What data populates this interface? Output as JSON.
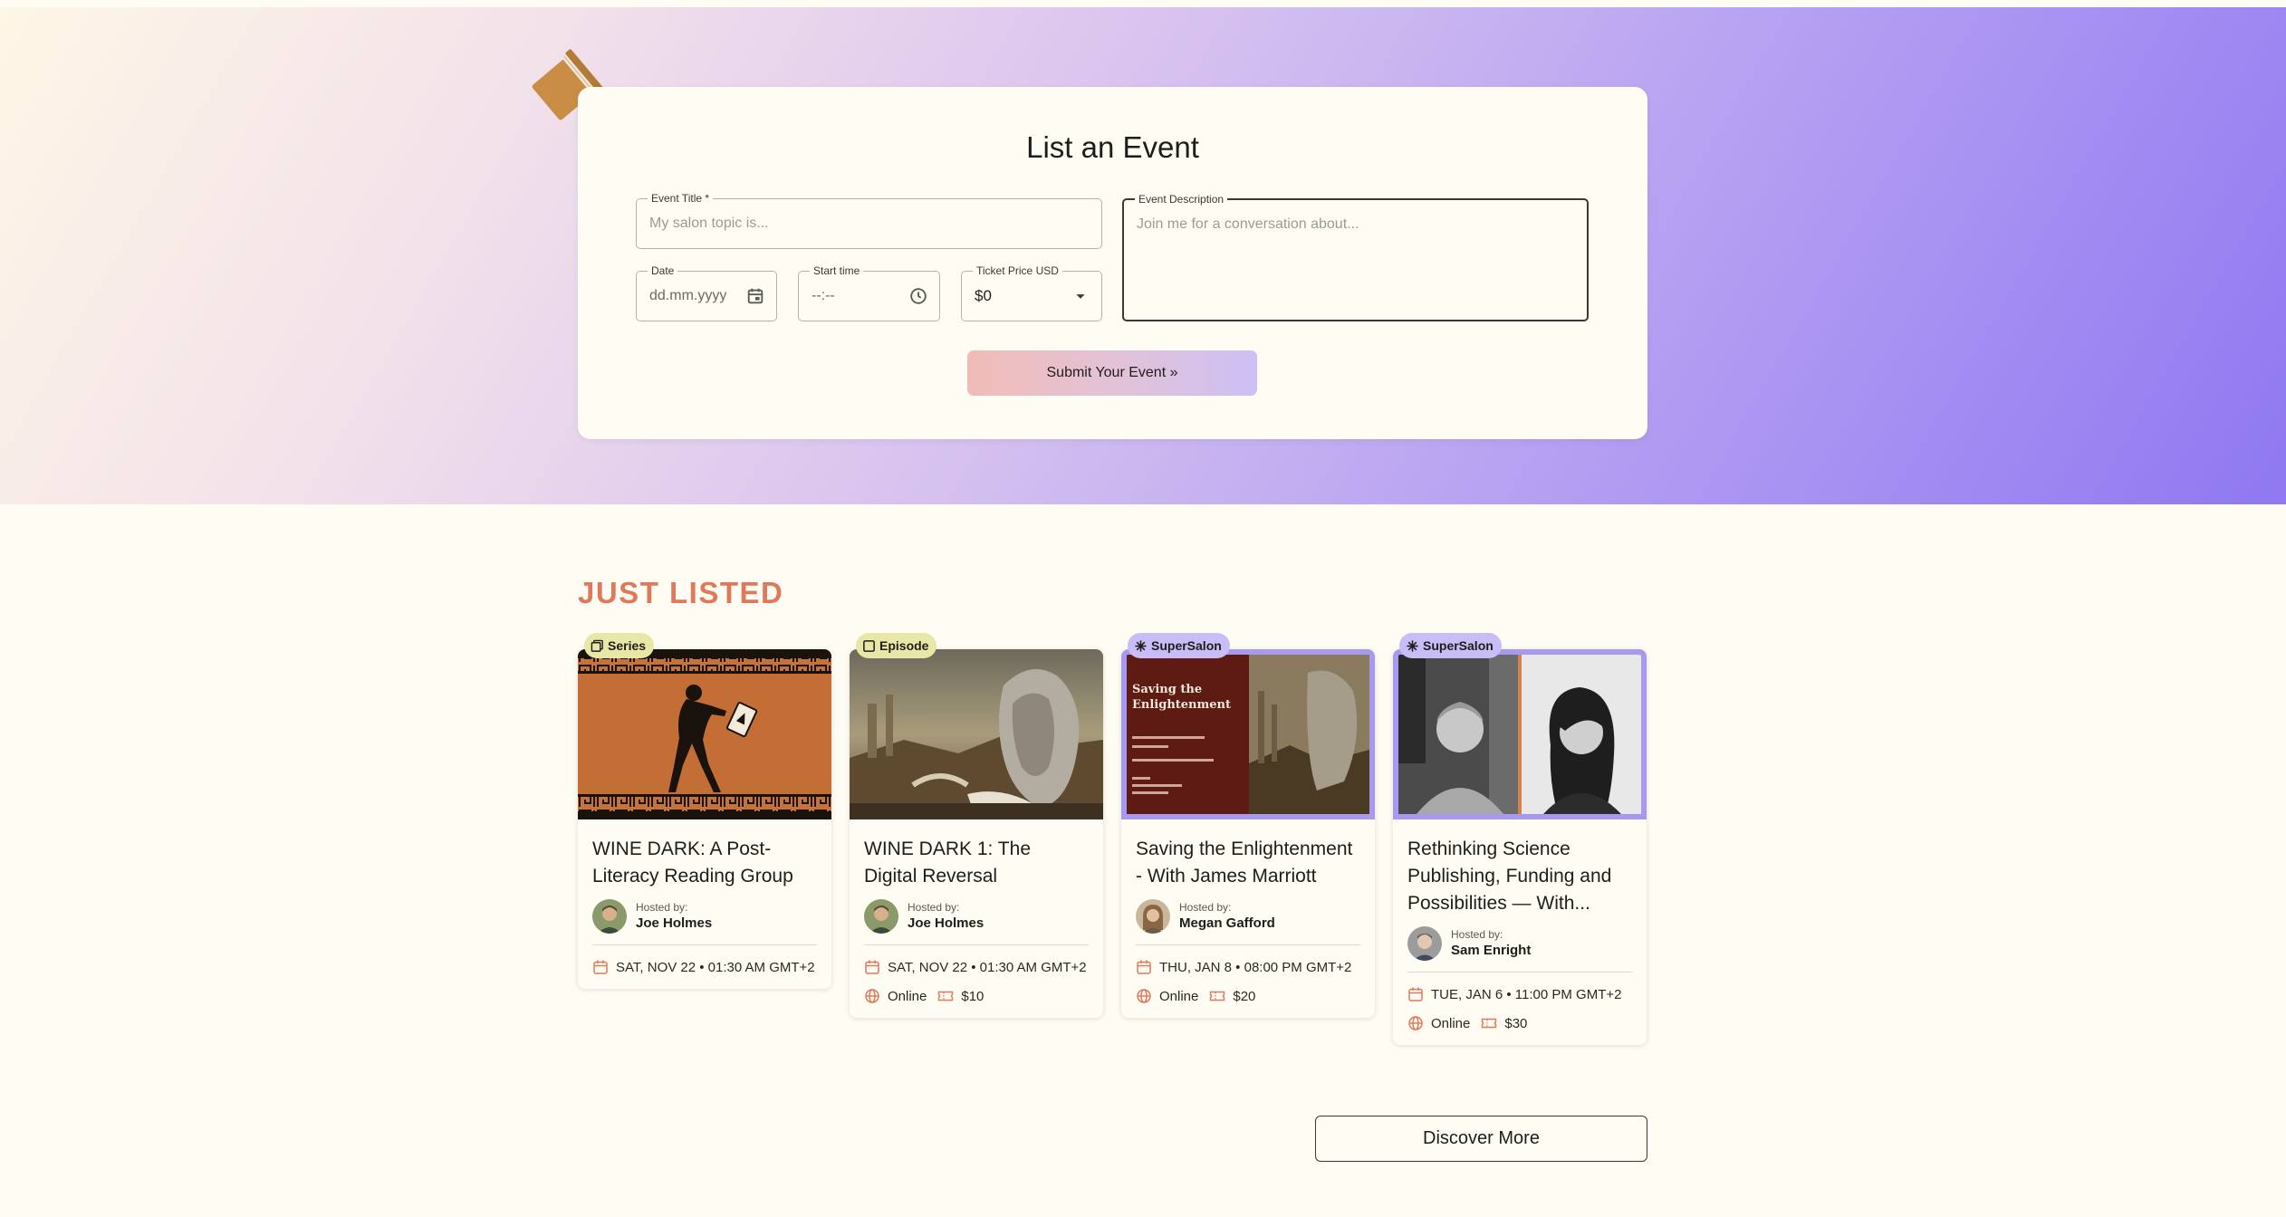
{
  "form": {
    "title": "List an Event",
    "event_title_label": "Event Title *",
    "event_title_placeholder": "My salon topic is...",
    "description_label": "Event Description",
    "description_placeholder": "Join me for a conversation about...",
    "date_label": "Date",
    "date_placeholder": "dd.mm.yyyy",
    "start_time_label": "Start time",
    "start_time_placeholder": "--:--",
    "price_label": "Ticket Price USD",
    "price_value": "$0",
    "submit_label": "Submit Your Event »"
  },
  "just_listed": {
    "title": "JUST LISTED",
    "cards": [
      {
        "badge": "Series",
        "title": "WINE DARK: A Post-Literacy Reading Group",
        "host_label": "Hosted by:",
        "host_name": "Joe Holmes",
        "datetime": "SAT, NOV 22 • 01:30 AM GMT+2"
      },
      {
        "badge": "Episode",
        "title": "WINE DARK 1: The Digital Reversal",
        "host_label": "Hosted by:",
        "host_name": "Joe Holmes",
        "datetime": "SAT, NOV 22 • 01:30 AM GMT+2",
        "location": "Online",
        "price": "$10"
      },
      {
        "badge": "SuperSalon",
        "title": "Saving the Enlightenment - With James Marriott",
        "host_label": "Hosted by:",
        "host_name": "Megan Gafford",
        "datetime": "THU, JAN 8 • 08:00 PM GMT+2",
        "location": "Online",
        "price": "$20",
        "poster_title": "Saving the Enlightenment"
      },
      {
        "badge": "SuperSalon",
        "title": "Rethinking Science Publishing, Funding and Possibilities — With...",
        "host_label": "Hosted by:",
        "host_name": "Sam Enright",
        "datetime": "TUE, JAN 6 • 11:00 PM GMT+2",
        "location": "Online",
        "price": "$30"
      }
    ],
    "discover_label": "Discover More"
  },
  "colors": {
    "accent_orange": "#e0785a",
    "supersalon_purple": "#a899f0",
    "page_bg": "#fffdf3"
  }
}
